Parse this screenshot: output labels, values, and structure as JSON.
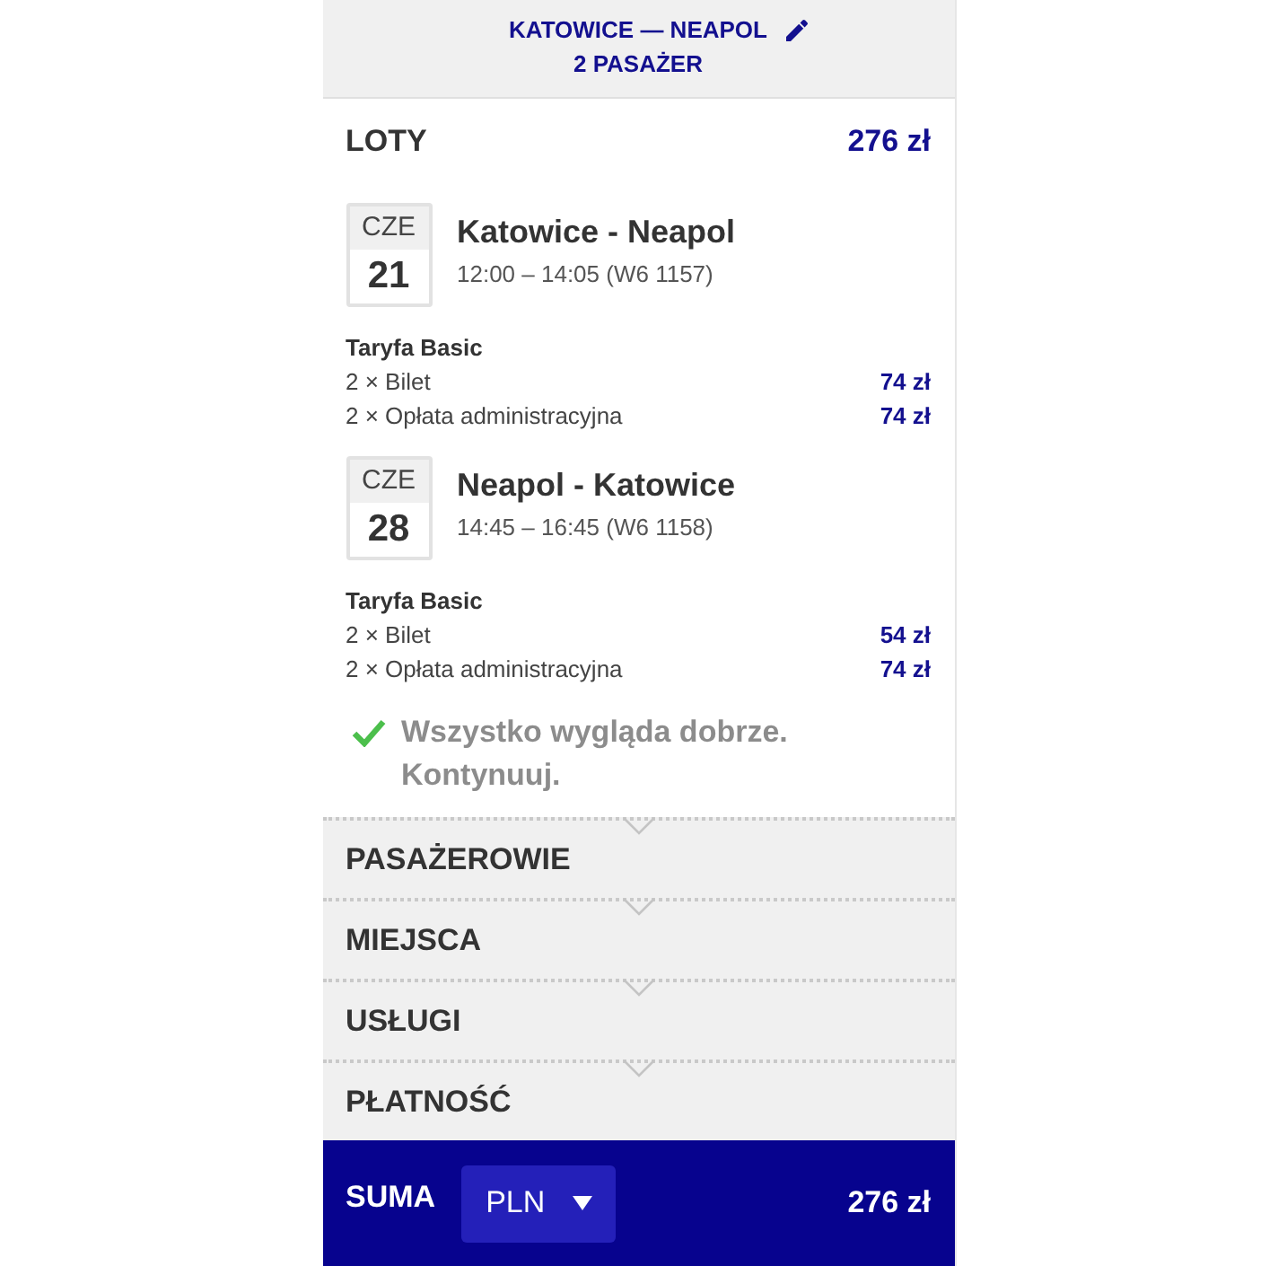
{
  "header": {
    "route": "KATOWICE — NEAPOL",
    "passengers": "2 PASAŻER"
  },
  "flights_section": {
    "title": "LOTY",
    "total": "276 zł"
  },
  "flights": [
    {
      "weekday": "CZE",
      "day": "21",
      "route": "Katowice - Neapol",
      "times": "12:00 – 14:05 (W6 1157)",
      "fare": "Taryfa Basic",
      "items": [
        {
          "label": "2 × Bilet",
          "price": "74 zł"
        },
        {
          "label": "2 × Opłata administracyjna",
          "price": "74 zł"
        }
      ]
    },
    {
      "weekday": "CZE",
      "day": "28",
      "route": "Neapol - Katowice",
      "times": "14:45 – 16:45 (W6 1158)",
      "fare": "Taryfa Basic",
      "items": [
        {
          "label": "2 × Bilet",
          "price": "54 zł"
        },
        {
          "label": "2 × Opłata administracyjna",
          "price": "74 zł"
        }
      ]
    }
  ],
  "status": {
    "message": "Wszystko wygląda dobrze. Kontynuuj."
  },
  "sections": [
    {
      "label": "PASAŻEROWIE"
    },
    {
      "label": "MIEJSCA"
    },
    {
      "label": "USŁUGI"
    },
    {
      "label": "PŁATNOŚĆ"
    }
  ],
  "footer": {
    "label": "SUMA",
    "currency": "PLN",
    "total": "276 zł"
  }
}
